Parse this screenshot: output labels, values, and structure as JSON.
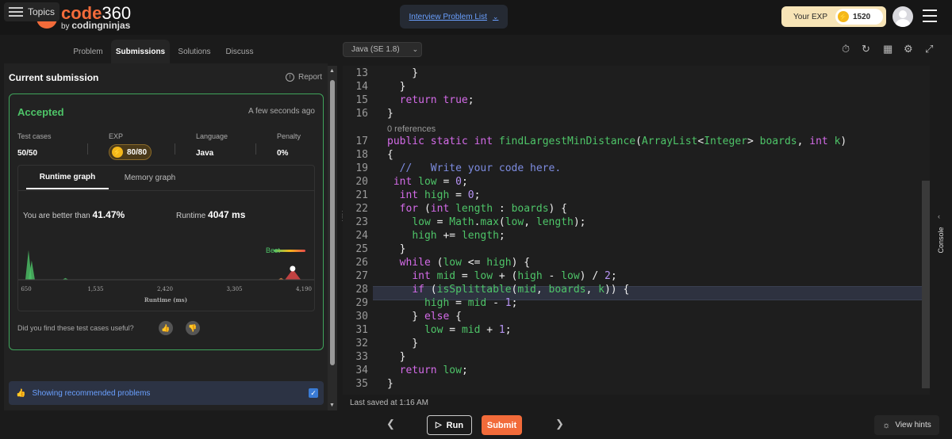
{
  "header": {
    "logo_letter": "C",
    "logo_main": "code",
    "logo_num": "360",
    "logo_by": "by",
    "logo_brand": "codingninjas",
    "problem_list": "Interview Problem List",
    "exp_label": "Your EXP",
    "exp_value": "1520"
  },
  "left_tabs": {
    "topics": "Topics",
    "problem": "Problem",
    "submissions": "Submissions",
    "solutions": "Solutions",
    "discuss": "Discuss"
  },
  "submission": {
    "title": "Current submission",
    "report": "Report",
    "status": "Accepted",
    "time": "A few seconds ago",
    "test_cases_label": "Test cases",
    "test_cases_value": "50/50",
    "exp_label": "EXP",
    "exp_value": "80/80",
    "language_label": "Language",
    "language_value": "Java",
    "penalty_label": "Penalty",
    "penalty_value": "0%",
    "runtime_tab": "Runtime graph",
    "memory_tab": "Memory graph",
    "better_text": "You are better than",
    "better_value": "41.47%",
    "runtime_label": "Runtime",
    "runtime_value": "4047 ms",
    "useful_text": "Did you find these test cases useful?",
    "recommended": "Showing recommended problems"
  },
  "chart_data": {
    "type": "area",
    "xlabel": "Runtime (ms)",
    "ticks": [
      "650",
      "1,535",
      "2,420",
      "3,305",
      "4,190"
    ],
    "xlim": [
      650,
      4190
    ],
    "legend": "Best",
    "current_runtime": 4047,
    "peaks": [
      {
        "x": 680,
        "height": 0.85
      },
      {
        "x": 720,
        "height": 0.55
      },
      {
        "x": 1150,
        "height": 0.05
      },
      {
        "x": 3900,
        "height": 0.05
      },
      {
        "x": 4050,
        "height": 0.3
      }
    ]
  },
  "editor": {
    "language": "Java (SE 1.8)",
    "references": "0 references",
    "last_saved": "Last saved at 1:16 AM",
    "line_numbers": [
      "13",
      "14",
      "15",
      "16",
      "17",
      "18",
      "19",
      "20",
      "21",
      "22",
      "23",
      "24",
      "25",
      "26",
      "27",
      "28",
      "29",
      "30",
      "31",
      "32",
      "33",
      "34",
      "35"
    ]
  },
  "bottom": {
    "run": "Run",
    "submit": "Submit",
    "hints": "View hints",
    "console": "Console"
  },
  "colors": {
    "accent": "#f26b3a",
    "accepted": "#4ec468",
    "keyword": "#d46be8",
    "identifier": "#4ec468",
    "number": "#b794f4",
    "comment": "#7d8ce0"
  }
}
